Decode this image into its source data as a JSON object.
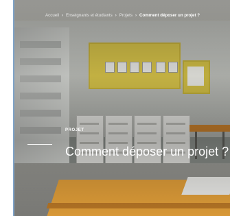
{
  "breadcrumb": {
    "items": [
      "Accueil",
      "Enseignants et étudiants",
      "Projets",
      "Comment déposer un projet ?"
    ],
    "separator": "›"
  },
  "hero": {
    "tag": "PROJET",
    "title": "Comment déposer un projet ?"
  }
}
